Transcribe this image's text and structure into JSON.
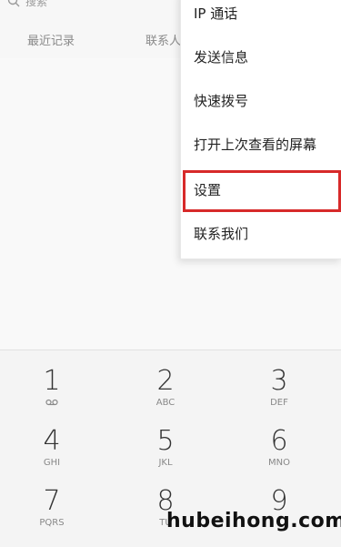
{
  "search": {
    "placeholder": "搜索"
  },
  "tabs": {
    "recent": "最近记录",
    "contacts": "联系人"
  },
  "menu": {
    "items": [
      {
        "label": "IP 通话"
      },
      {
        "label": "发送信息"
      },
      {
        "label": "快速拨号"
      },
      {
        "label": "打开上次查看的屏幕"
      },
      {
        "label": "设置"
      },
      {
        "label": "联系我们"
      }
    ],
    "highlighted": "设置",
    "highlight_color": "#d72a2a"
  },
  "dialpad": {
    "keys": [
      {
        "digit": "1",
        "letters": "",
        "icon": "voicemail-icon"
      },
      {
        "digit": "2",
        "letters": "ABC"
      },
      {
        "digit": "3",
        "letters": "DEF"
      },
      {
        "digit": "4",
        "letters": "GHI"
      },
      {
        "digit": "5",
        "letters": "JKL"
      },
      {
        "digit": "6",
        "letters": "MNO"
      },
      {
        "digit": "7",
        "letters": "PQRS"
      },
      {
        "digit": "8",
        "letters": "TU"
      },
      {
        "digit": "9",
        "letters": ""
      }
    ]
  },
  "watermark": "hubeihong.com"
}
